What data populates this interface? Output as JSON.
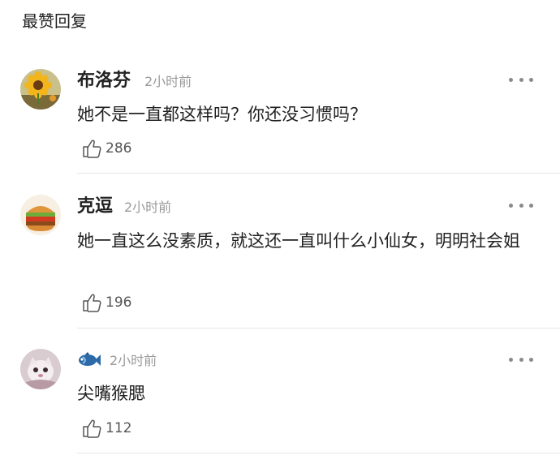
{
  "section_title": "最赞回复",
  "comments": [
    {
      "username": "布洛芬",
      "time": "2小时前",
      "content": "她不是一直都这样吗？你还没习惯吗？",
      "likes": "286",
      "avatar_icon": "sunflower-avatar"
    },
    {
      "username": "克逗",
      "time": "2小时前",
      "content": "她一直这么没素质，就这还一直叫什么小仙女，明明社会姐",
      "likes": "196",
      "avatar_icon": "burger-avatar"
    },
    {
      "username": "",
      "username_icon": "fish-icon",
      "time": "2小时前",
      "content": "尖嘴猴腮",
      "likes": "112",
      "avatar_icon": "cat-avatar"
    }
  ]
}
